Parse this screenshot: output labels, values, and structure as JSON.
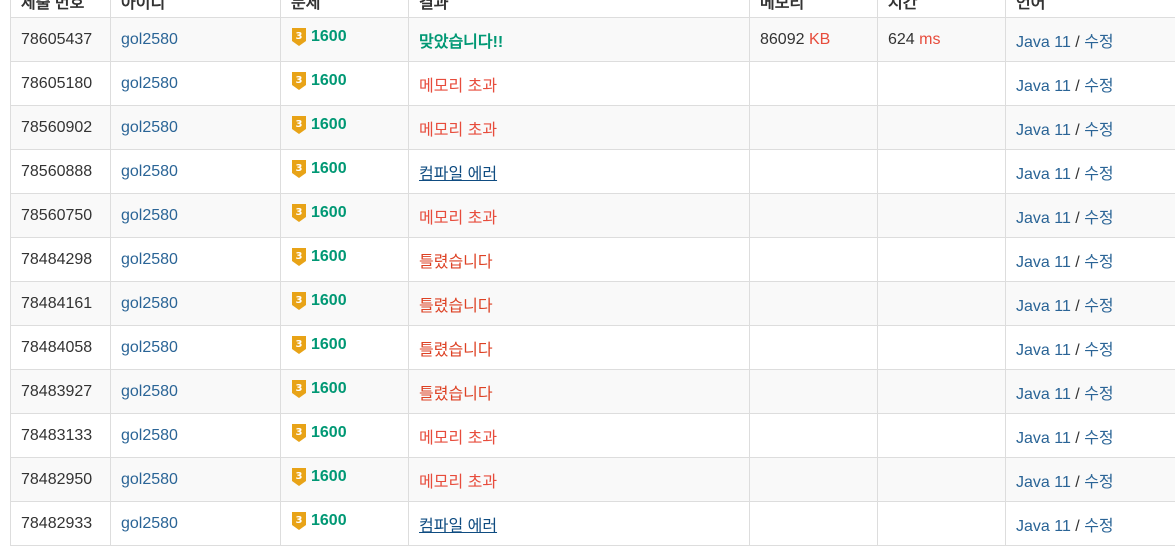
{
  "table": {
    "headers": [
      "제출 번호",
      "아이디",
      "문제",
      "결과",
      "메모리",
      "시간",
      "언어"
    ],
    "rows": [
      {
        "id": "78605437",
        "user": "gol2580",
        "tier": "3",
        "problem": "1600",
        "result": "맞았습니다!!",
        "result_type": "ac",
        "memory": "86092",
        "memory_unit": "KB",
        "time": "624",
        "time_unit": "ms",
        "language": "Java 11",
        "sep": " / ",
        "edit": "수정"
      },
      {
        "id": "78605180",
        "user": "gol2580",
        "tier": "3",
        "problem": "1600",
        "result": "메모리 초과",
        "result_type": "mle",
        "memory": "",
        "memory_unit": "",
        "time": "",
        "time_unit": "",
        "language": "Java 11",
        "sep": " / ",
        "edit": "수정"
      },
      {
        "id": "78560902",
        "user": "gol2580",
        "tier": "3",
        "problem": "1600",
        "result": "메모리 초과",
        "result_type": "mle",
        "memory": "",
        "memory_unit": "",
        "time": "",
        "time_unit": "",
        "language": "Java 11",
        "sep": " / ",
        "edit": "수정"
      },
      {
        "id": "78560888",
        "user": "gol2580",
        "tier": "3",
        "problem": "1600",
        "result": "컴파일 에러",
        "result_type": "ce",
        "memory": "",
        "memory_unit": "",
        "time": "",
        "time_unit": "",
        "language": "Java 11",
        "sep": " / ",
        "edit": "수정"
      },
      {
        "id": "78560750",
        "user": "gol2580",
        "tier": "3",
        "problem": "1600",
        "result": "메모리 초과",
        "result_type": "mle",
        "memory": "",
        "memory_unit": "",
        "time": "",
        "time_unit": "",
        "language": "Java 11",
        "sep": " / ",
        "edit": "수정"
      },
      {
        "id": "78484298",
        "user": "gol2580",
        "tier": "3",
        "problem": "1600",
        "result": "틀렸습니다",
        "result_type": "wa",
        "memory": "",
        "memory_unit": "",
        "time": "",
        "time_unit": "",
        "language": "Java 11",
        "sep": " / ",
        "edit": "수정"
      },
      {
        "id": "78484161",
        "user": "gol2580",
        "tier": "3",
        "problem": "1600",
        "result": "틀렸습니다",
        "result_type": "wa",
        "memory": "",
        "memory_unit": "",
        "time": "",
        "time_unit": "",
        "language": "Java 11",
        "sep": " / ",
        "edit": "수정"
      },
      {
        "id": "78484058",
        "user": "gol2580",
        "tier": "3",
        "problem": "1600",
        "result": "틀렸습니다",
        "result_type": "wa",
        "memory": "",
        "memory_unit": "",
        "time": "",
        "time_unit": "",
        "language": "Java 11",
        "sep": " / ",
        "edit": "수정"
      },
      {
        "id": "78483927",
        "user": "gol2580",
        "tier": "3",
        "problem": "1600",
        "result": "틀렸습니다",
        "result_type": "wa",
        "memory": "",
        "memory_unit": "",
        "time": "",
        "time_unit": "",
        "language": "Java 11",
        "sep": " / ",
        "edit": "수정"
      },
      {
        "id": "78483133",
        "user": "gol2580",
        "tier": "3",
        "problem": "1600",
        "result": "메모리 초과",
        "result_type": "mle",
        "memory": "",
        "memory_unit": "",
        "time": "",
        "time_unit": "",
        "language": "Java 11",
        "sep": " / ",
        "edit": "수정"
      },
      {
        "id": "78482950",
        "user": "gol2580",
        "tier": "3",
        "problem": "1600",
        "result": "메모리 초과",
        "result_type": "mle",
        "memory": "",
        "memory_unit": "",
        "time": "",
        "time_unit": "",
        "language": "Java 11",
        "sep": " / ",
        "edit": "수정"
      },
      {
        "id": "78482933",
        "user": "gol2580",
        "tier": "3",
        "problem": "1600",
        "result": "컴파일 에러",
        "result_type": "ce",
        "memory": "",
        "memory_unit": "",
        "time": "",
        "time_unit": "",
        "language": "Java 11",
        "sep": " / ",
        "edit": "수정"
      }
    ]
  },
  "colors": {
    "tier_gold": "#e8a317",
    "accepted": "#009874",
    "memory_exceeded": "#e74c3c",
    "wrong_answer": "#dd4124",
    "compile_error": "#0f4c81",
    "link": "#2a6496"
  },
  "icons": {
    "tier": "gold-tier-icon"
  }
}
